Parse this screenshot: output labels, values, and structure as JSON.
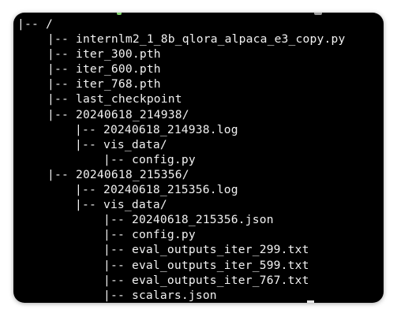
{
  "terminal": {
    "lines": [
      {
        "prefix": "|-- ",
        "name": "/",
        "indent": 0
      },
      {
        "prefix": "|-- ",
        "name": "internlm2_1_8b_qlora_alpaca_e3_copy.py",
        "indent": 1
      },
      {
        "prefix": "|-- ",
        "name": "iter_300.pth",
        "indent": 1
      },
      {
        "prefix": "|-- ",
        "name": "iter_600.pth",
        "indent": 1
      },
      {
        "prefix": "|-- ",
        "name": "iter_768.pth",
        "indent": 1
      },
      {
        "prefix": "|-- ",
        "name": "last_checkpoint",
        "indent": 1
      },
      {
        "prefix": "|-- ",
        "name": "20240618_214938/",
        "indent": 1
      },
      {
        "prefix": "|-- ",
        "name": "20240618_214938.log",
        "indent": 2
      },
      {
        "prefix": "|-- ",
        "name": "vis_data/",
        "indent": 2
      },
      {
        "prefix": "|-- ",
        "name": "config.py",
        "indent": 3
      },
      {
        "prefix": "|-- ",
        "name": "20240618_215356/",
        "indent": 1
      },
      {
        "prefix": "|-- ",
        "name": "20240618_215356.log",
        "indent": 2
      },
      {
        "prefix": "|-- ",
        "name": "vis_data/",
        "indent": 2
      },
      {
        "prefix": "|-- ",
        "name": "20240618_215356.json",
        "indent": 3
      },
      {
        "prefix": "|-- ",
        "name": "config.py",
        "indent": 3
      },
      {
        "prefix": "|-- ",
        "name": "eval_outputs_iter_299.txt",
        "indent": 3
      },
      {
        "prefix": "|-- ",
        "name": "eval_outputs_iter_599.txt",
        "indent": 3
      },
      {
        "prefix": "|-- ",
        "name": "eval_outputs_iter_767.txt",
        "indent": 3
      },
      {
        "prefix": "|-- ",
        "name": "scalars.json",
        "indent": 3
      }
    ]
  },
  "colors": {
    "background": "#000000",
    "text": "#f2f2f2",
    "page": "#ffffff"
  }
}
